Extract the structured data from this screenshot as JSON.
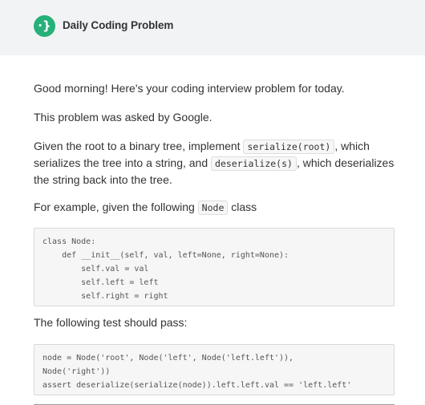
{
  "header": {
    "title": "Daily Coding Problem",
    "logo_glyph": "·}",
    "logo_color": "#27b07a"
  },
  "body": {
    "greeting": "Good morning! Here's your coding interview problem for today.",
    "asked_by": "This problem was asked by Google.",
    "desc_1": "Given the root to a binary tree, implement ",
    "code_serialize": "serialize(root)",
    "desc_2": ", which serializes the tree into a string, and ",
    "code_deserialize": "deserialize(s)",
    "desc_3": ", which deserializes the string back into the tree.",
    "example_1": "For example, given the following ",
    "code_node": "Node",
    "example_2": " class",
    "class_code": "class Node:\n    def __init__(self, val, left=None, right=None):\n        self.val = val\n        self.left = left\n        self.right = right",
    "test_intro": "The following test should pass:",
    "test_code": "node = Node('root', Node('left', Node('left.left')),\nNode('right'))\nassert deserialize(serialize(node)).left.left.val == 'left.left'"
  }
}
